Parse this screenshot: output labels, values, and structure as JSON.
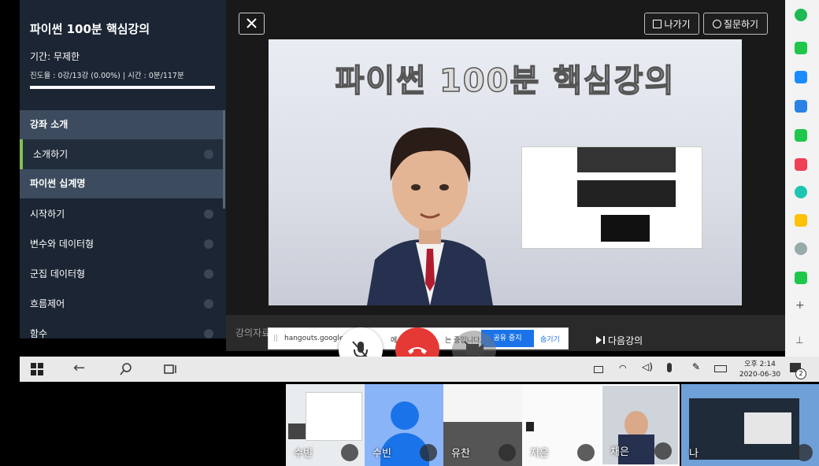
{
  "sidebar": {
    "course_title": "파이썬 100분 핵심강의",
    "period": "기간: 무제한",
    "progress_text": "진도율 : 0강/13강 (0.00%) | 시간 : 0분/117분",
    "progress_fraction": 0.0,
    "sections": [
      {
        "label": "강좌 소개"
      },
      {
        "label": "파이썬 십계명"
      }
    ],
    "items": [
      {
        "label": "소개하기"
      },
      {
        "label": "시작하기"
      },
      {
        "label": "변수와 데이터형"
      },
      {
        "label": "군집 데이터형"
      },
      {
        "label": "흐름제어"
      },
      {
        "label": "함수"
      }
    ]
  },
  "player": {
    "slide_heading": "파이썬 100분 핵심강의",
    "exit_label": "나가기",
    "ask_label": "질문하기",
    "next_label": "다음강의",
    "behind_text": "강의자료"
  },
  "share_bar": {
    "text_left": "hangouts.google",
    "text_right": "에 화면",
    "text_tail": "는 중입니다.",
    "stop_label": "공유 중지",
    "hide_label": "숨기기"
  },
  "taskbar": {
    "time": "오후 2:14",
    "date": "2020-06-30",
    "notification_count": "2"
  },
  "participants": [
    {
      "name": "수빈"
    },
    {
      "name": "수빈"
    },
    {
      "name": "유찬"
    },
    {
      "name": "지은"
    },
    {
      "name": "채은"
    },
    {
      "name": "나"
    }
  ],
  "colors": {
    "sidebar_bg": "#1b2533",
    "section_bg": "#3d4b5e",
    "active_accent": "#7fc250",
    "end_call": "#e53935",
    "share_stop": "#1a73e8"
  }
}
